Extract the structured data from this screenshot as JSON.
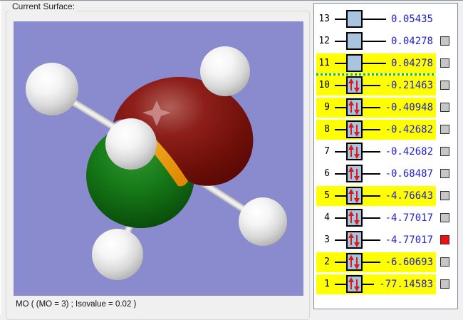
{
  "window": {
    "background": "#f0f0f0"
  },
  "surface_panel": {
    "title": "Current Surface:",
    "caption": "MO ( (MO = 3) ; Isovalue = 0.02 )",
    "viewport_background": "#8a8ace",
    "molecule": {
      "hydrogen_atom_count": 5,
      "hydrogen_color": "#ffffff",
      "central_atom_color": "#f29d1e",
      "positive_lobe_color": "#7a1111",
      "negative_lobe_color": "#10660f",
      "bond_color": "#d4d4d4"
    }
  },
  "mo_list": {
    "energy_text_color": "#2222cc",
    "highlight_color": "#ffff00",
    "separator_color": "#00cc00",
    "homo_lumo_separator_after_mo": 11,
    "rows": [
      {
        "mo": 13,
        "energy": "0.05435",
        "occupied": false,
        "highlighted": false,
        "checkbox": "none"
      },
      {
        "mo": 12,
        "energy": "0.04278",
        "occupied": false,
        "highlighted": false,
        "checkbox": "gray"
      },
      {
        "mo": 11,
        "energy": "0.04278",
        "occupied": false,
        "highlighted": true,
        "checkbox": "gray"
      },
      {
        "mo": 10,
        "energy": "-0.21463",
        "occupied": true,
        "highlighted": true,
        "checkbox": "gray"
      },
      {
        "mo": 9,
        "energy": "-0.40948",
        "occupied": true,
        "highlighted": true,
        "checkbox": "gray"
      },
      {
        "mo": 8,
        "energy": "-0.42682",
        "occupied": true,
        "highlighted": true,
        "checkbox": "gray"
      },
      {
        "mo": 7,
        "energy": "-0.42682",
        "occupied": true,
        "highlighted": false,
        "checkbox": "gray"
      },
      {
        "mo": 6,
        "energy": "-0.68487",
        "occupied": true,
        "highlighted": false,
        "checkbox": "gray"
      },
      {
        "mo": 5,
        "energy": "-4.76643",
        "occupied": true,
        "highlighted": true,
        "checkbox": "gray"
      },
      {
        "mo": 4,
        "energy": "-4.77017",
        "occupied": true,
        "highlighted": false,
        "checkbox": "gray"
      },
      {
        "mo": 3,
        "energy": "-4.77017",
        "occupied": true,
        "highlighted": false,
        "checkbox": "red"
      },
      {
        "mo": 2,
        "energy": "-6.60693",
        "occupied": true,
        "highlighted": true,
        "checkbox": "gray"
      },
      {
        "mo": 1,
        "energy": "-77.14583",
        "occupied": true,
        "highlighted": true,
        "checkbox": "gray"
      }
    ]
  }
}
